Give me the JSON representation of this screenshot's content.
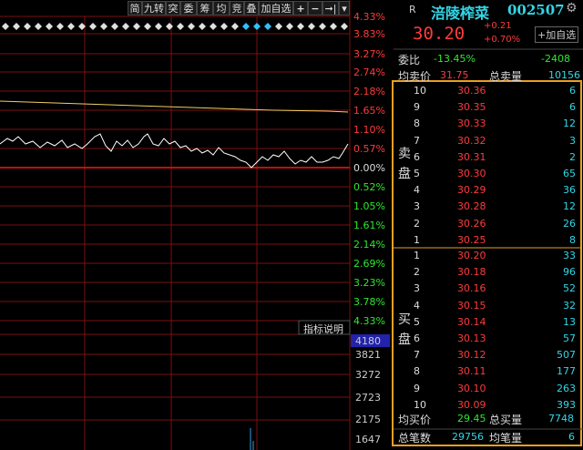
{
  "toolbar": {
    "buttons": [
      "简",
      "九转",
      "突",
      "委",
      "筹",
      "均",
      "竞",
      "叠",
      "加自选"
    ],
    "icons": [
      "plus-icon",
      "minus-icon",
      "arrow-right-bar-icon",
      "chevron-down-icon"
    ]
  },
  "chart": {
    "pct_labels_up": [
      "4.33%",
      "3.83%",
      "3.27%",
      "2.74%",
      "2.18%",
      "1.65%",
      "1.10%",
      "0.57%"
    ],
    "pct_zero": "0.00%",
    "pct_labels_down": [
      "0.52%",
      "1.05%",
      "1.61%",
      "2.14%",
      "2.69%",
      "3.23%",
      "3.78%",
      "4.33%"
    ],
    "indicator_label": "指标说明",
    "volume_labels": [
      "4180",
      "3821",
      "3272",
      "2723",
      "2175",
      "1647"
    ],
    "colors": {
      "up": "#ff3b3b",
      "down": "#2ee82e",
      "price_line": "#ffffff",
      "avg_line": "#f0d060"
    }
  },
  "stock": {
    "market_badge": "R",
    "name": "涪陵榨菜",
    "code": "002507",
    "price": "30.20",
    "change": "+0.21",
    "change_pct": "+0.70%",
    "add_favorite": "+加自选",
    "ratio_label": "委比",
    "ratio_value": "-13.45%",
    "ratio_diff": "-2408",
    "avg_sell_label": "均卖价",
    "avg_sell_value": "31.75",
    "total_sell_label": "总卖量",
    "total_sell_value": "10156",
    "sell_label": "卖盘",
    "buy_label": "买盘",
    "avg_buy_label": "均买价",
    "avg_buy_value": "29.45",
    "total_buy_label": "总买量",
    "total_buy_value": "7748",
    "total_orders_label": "总笔数",
    "total_orders_value": "29756",
    "avg_orders_label": "均笔量",
    "avg_orders_value": "6"
  },
  "asks": [
    {
      "level": "10",
      "price": "30.36",
      "qty": "6"
    },
    {
      "level": "9",
      "price": "30.35",
      "qty": "6"
    },
    {
      "level": "8",
      "price": "30.33",
      "qty": "12"
    },
    {
      "level": "7",
      "price": "30.32",
      "qty": "3"
    },
    {
      "level": "6",
      "price": "30.31",
      "qty": "2"
    },
    {
      "level": "5",
      "price": "30.30",
      "qty": "65"
    },
    {
      "level": "4",
      "price": "30.29",
      "qty": "36"
    },
    {
      "level": "3",
      "price": "30.28",
      "qty": "12"
    },
    {
      "level": "2",
      "price": "30.26",
      "qty": "26"
    },
    {
      "level": "1",
      "price": "30.25",
      "qty": "8"
    }
  ],
  "bids": [
    {
      "level": "1",
      "price": "30.20",
      "qty": "33"
    },
    {
      "level": "2",
      "price": "30.18",
      "qty": "96"
    },
    {
      "level": "3",
      "price": "30.16",
      "qty": "52"
    },
    {
      "level": "4",
      "price": "30.15",
      "qty": "32"
    },
    {
      "level": "5",
      "price": "30.14",
      "qty": "13"
    },
    {
      "level": "6",
      "price": "30.13",
      "qty": "57"
    },
    {
      "level": "7",
      "price": "30.12",
      "qty": "507"
    },
    {
      "level": "8",
      "price": "30.11",
      "qty": "177"
    },
    {
      "level": "9",
      "price": "30.10",
      "qty": "263"
    },
    {
      "level": "10",
      "price": "30.09",
      "qty": "393"
    }
  ]
}
